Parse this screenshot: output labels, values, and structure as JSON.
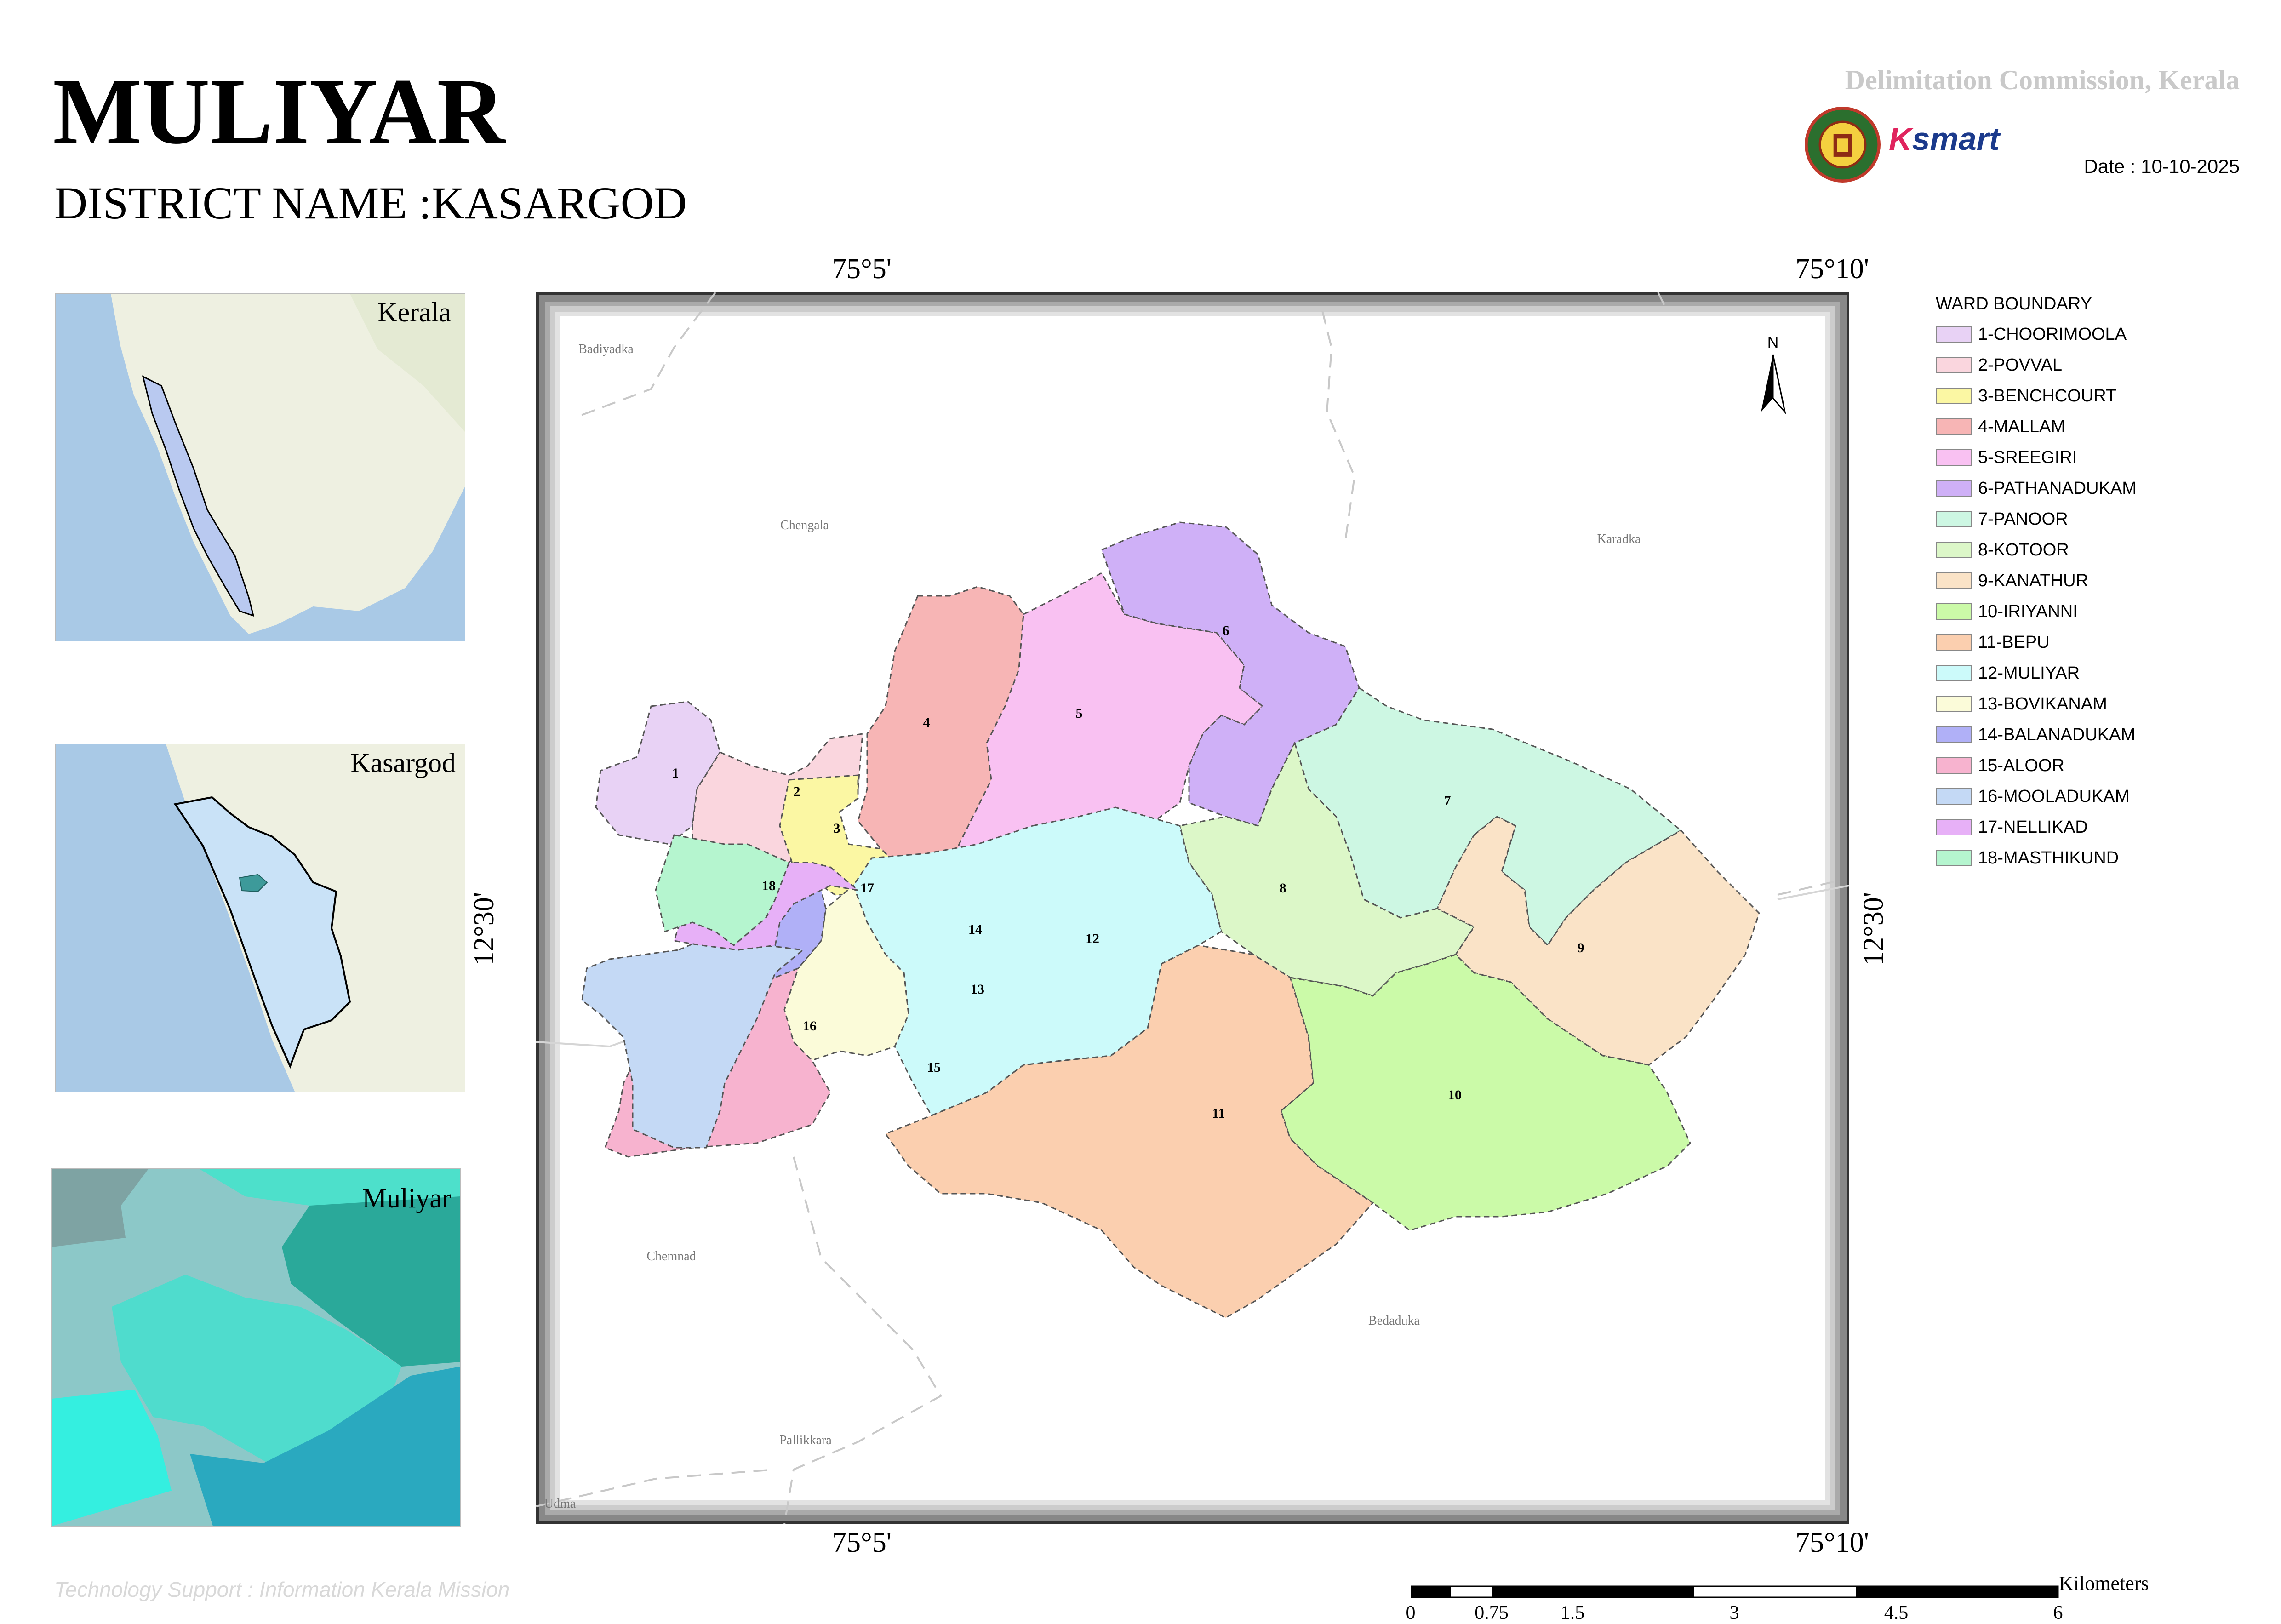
{
  "header": {
    "title": "MULIYAR",
    "district": "DISTRICT NAME :KASARGOD",
    "commission": "Delimitation Commission, Kerala",
    "date": "Date : 10-10-2025",
    "ksmart_k": "K",
    "ksmart_rest": "smart"
  },
  "insets": {
    "kerala": "Kerala",
    "kasargod": "Kasargod",
    "muliyar": "Muliyar"
  },
  "coordinates": {
    "top_left": "75°5'",
    "top_right": "75°10'",
    "bottom_left": "75°5'",
    "bottom_right": "75°10'",
    "left_lat": "12°30'",
    "right_lat": "12°30'"
  },
  "places": {
    "badiyadka": "Badiyadka",
    "chengala": "Chengala",
    "karadka": "Karadka",
    "chemnad": "Chemnad",
    "bedaduka": "Bedaduka",
    "pallikkara": "Pallikkara",
    "udma": "Udma"
  },
  "legend": {
    "title": "WARD BOUNDARY",
    "items": [
      {
        "label": "1-CHOORIMOOLA",
        "color": "#e8d2f5"
      },
      {
        "label": "2-POVVAL",
        "color": "#fad6de"
      },
      {
        "label": "3-BENCHCOURT",
        "color": "#fbf7a3"
      },
      {
        "label": "4-MALLAM",
        "color": "#f7b5b5"
      },
      {
        "label": "5-SREEGIRI",
        "color": "#f9c1f2"
      },
      {
        "label": "6-PATHANADUKAM",
        "color": "#cfb0f7"
      },
      {
        "label": "7-PANOOR",
        "color": "#cdf7e3"
      },
      {
        "label": "8-KOTOOR",
        "color": "#dcf7c8"
      },
      {
        "label": "9-KANATHUR",
        "color": "#fae3c7"
      },
      {
        "label": "10-IRIYANNI",
        "color": "#cbfaa8"
      },
      {
        "label": "11-BEPU",
        "color": "#fbcfaf"
      },
      {
        "label": "12-MULIYAR",
        "color": "#ccfafa"
      },
      {
        "label": "13-BOVIKANAM",
        "color": "#fbfbd9"
      },
      {
        "label": "14-BALANADUKAM",
        "color": "#b0b0f7"
      },
      {
        "label": "15-ALOOR",
        "color": "#f7b3cf"
      },
      {
        "label": "16-MOOLADUKAM",
        "color": "#c4d9f5"
      },
      {
        "label": "17-NELLIKAD",
        "color": "#e7b0f7"
      },
      {
        "label": "18-MASTHIKUND",
        "color": "#b5f5cf"
      }
    ]
  },
  "wards": [
    "1",
    "2",
    "3",
    "4",
    "5",
    "6",
    "7",
    "8",
    "9",
    "10",
    "11",
    "12",
    "13",
    "14",
    "15",
    "16",
    "17",
    "18"
  ],
  "north": "N",
  "scale": {
    "unit": "Kilometers",
    "ticks": [
      "0",
      "0.75",
      "1.5",
      "3",
      "4.5",
      "6"
    ]
  },
  "footer": {
    "support": "Technology Support : Information Kerala Mission"
  }
}
